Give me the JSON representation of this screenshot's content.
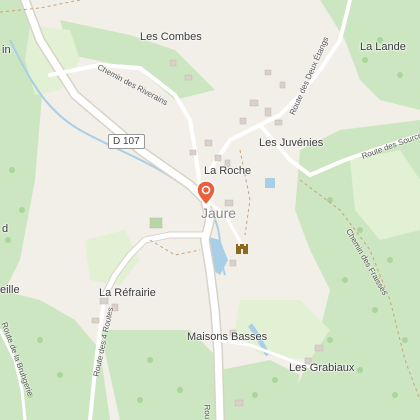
{
  "map": {
    "place_labels": {
      "les_combes": "Les Combes",
      "la_lande": "La Lande",
      "les_juvenies": "Les Juvénies",
      "la_roche": "La Roche",
      "la_refrairie": "La Réfrairie",
      "maisons_basses": "Maisons Basses",
      "les_grabiaux": "Les Grabiaux",
      "edge_in": "in",
      "edge_d": "d",
      "edge_eille": "eille"
    },
    "main_place": "Jaure",
    "road_shield": "D 107",
    "road_labels": {
      "chemin_riverains": "Chemin des Riverains",
      "route_deux_etangs": "Route des Deux Étangs",
      "route_sources": "Route des Sources",
      "chemin_fraisses": "Chemin des Fraisses",
      "route_4_routes": "Route des 4 Routes",
      "route_bruhgerie": "Route de la Bruhgerie",
      "route_bottom": "Rou"
    },
    "icons": {
      "marker": "location-pin-icon",
      "castle": "castle-icon"
    },
    "colors": {
      "land": "#f2efe9",
      "forest": "#cde6c2",
      "meadow": "#e2f0d4",
      "water": "#a9cfe6",
      "road": "#ffffff",
      "road_casing": "#d8d2c8",
      "building": "#d9d0c9",
      "marker": "#e8603c",
      "castle": "#8b6a1e"
    }
  }
}
